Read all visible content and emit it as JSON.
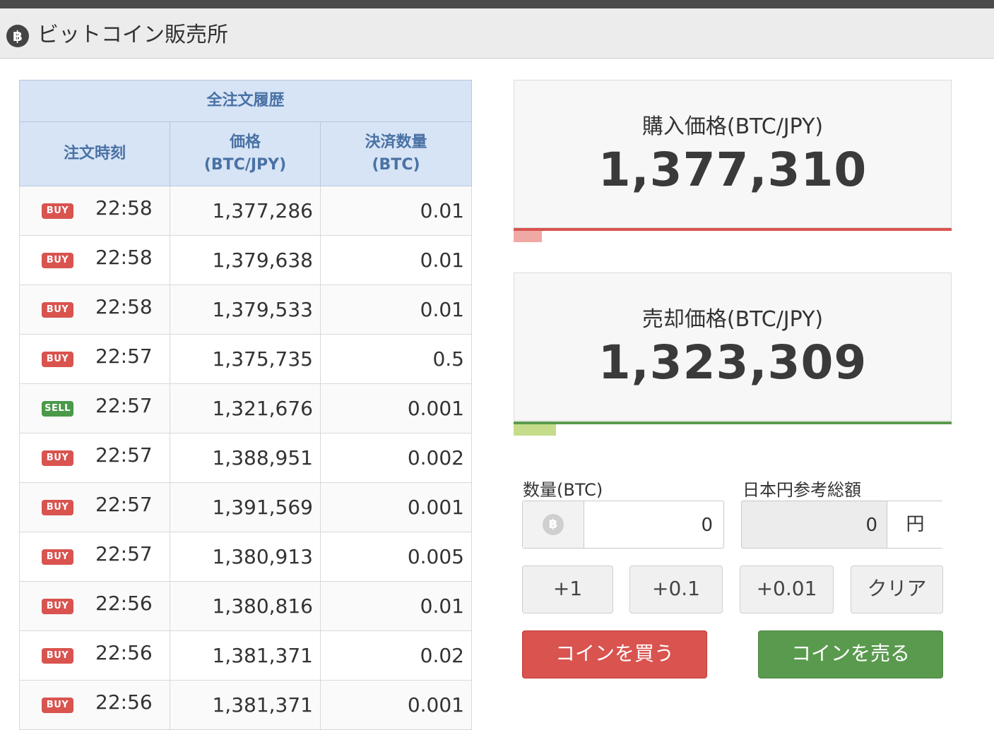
{
  "header": {
    "title": "ビットコイン販売所",
    "logo": "bitcoin-icon"
  },
  "orders": {
    "caption": "全注文履歴",
    "columns": {
      "time": "注文時刻",
      "price_l1": "価格",
      "price_l2": "(BTC/JPY)",
      "amount_l1": "決済数量",
      "amount_l2": "(BTC)"
    },
    "rows": [
      {
        "side": "BUY",
        "time": "22:58",
        "price": "1,377,286",
        "amount": "0.01"
      },
      {
        "side": "BUY",
        "time": "22:58",
        "price": "1,379,638",
        "amount": "0.01"
      },
      {
        "side": "BUY",
        "time": "22:58",
        "price": "1,379,533",
        "amount": "0.01"
      },
      {
        "side": "BUY",
        "time": "22:57",
        "price": "1,375,735",
        "amount": "0.5"
      },
      {
        "side": "SELL",
        "time": "22:57",
        "price": "1,321,676",
        "amount": "0.001"
      },
      {
        "side": "BUY",
        "time": "22:57",
        "price": "1,388,951",
        "amount": "0.002"
      },
      {
        "side": "BUY",
        "time": "22:57",
        "price": "1,391,569",
        "amount": "0.001"
      },
      {
        "side": "BUY",
        "time": "22:57",
        "price": "1,380,913",
        "amount": "0.005"
      },
      {
        "side": "BUY",
        "time": "22:56",
        "price": "1,380,816",
        "amount": "0.01"
      },
      {
        "side": "BUY",
        "time": "22:56",
        "price": "1,381,371",
        "amount": "0.02"
      },
      {
        "side": "BUY",
        "time": "22:56",
        "price": "1,381,371",
        "amount": "0.001"
      }
    ]
  },
  "buy_price": {
    "label": "購入価格(BTC/JPY)",
    "value": "1,377,310",
    "color": "#d9534f"
  },
  "sell_price": {
    "label": "売却価格(BTC/JPY)",
    "value": "1,323,309",
    "color": "#5a9a4e"
  },
  "form": {
    "qty_label": "数量(BTC)",
    "qty_value": "0",
    "yen_label": "日本円参考総額",
    "yen_value": "0",
    "yen_unit": "円",
    "inc_buttons": [
      "+1",
      "+0.1",
      "+0.01"
    ],
    "clear": "クリア",
    "buy_button": "コインを買う",
    "sell_button": "コインを売る"
  }
}
